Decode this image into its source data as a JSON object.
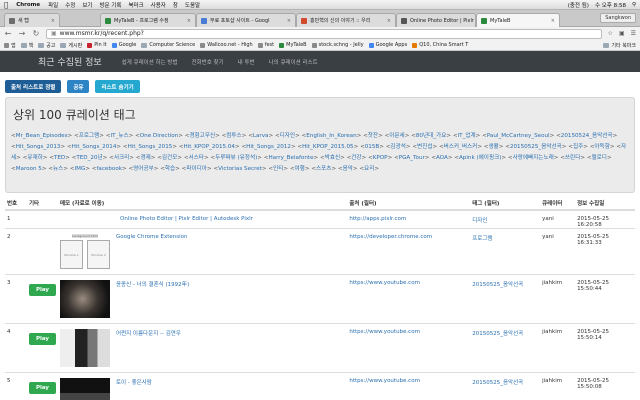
{
  "menubar": {
    "app": "Chrome",
    "items": [
      "파일",
      "수정",
      "보기",
      "방문 기록",
      "북마크",
      "사용자",
      "창",
      "도움말"
    ],
    "status": "(충전 됨)",
    "clock": "수 오후 8:58"
  },
  "tabs": [
    {
      "label": "새 탭",
      "active": false,
      "color": "#6d6d6d"
    },
    {
      "label": "MyTaleB - 프로그램 수정",
      "active": false,
      "color": "#2b8a3e"
    },
    {
      "label": "무료 포토샵 사이트 - Googl",
      "active": false,
      "color": "#4a7bd3"
    },
    {
      "label": "홍민혁의 신의 이야기 :: 우리",
      "active": false,
      "color": "#d04a2b"
    },
    {
      "label": "Online Photo Editor | Pixlr",
      "active": false,
      "color": "#555"
    },
    {
      "label": "MyTaleB",
      "active": true,
      "color": "#2b8a3e"
    }
  ],
  "profile": "Sangkwon",
  "address": {
    "prefix": "www.",
    "url": "www.msmr.kr/q/recent.php?"
  },
  "bookmarks": [
    "앱",
    "책",
    "공고",
    "게시판",
    "Pin It",
    "Google",
    "Computer Science",
    "Wallcoo.net - High",
    "fest",
    "MyTaleB",
    "stock.schng - Jelly",
    "Google Apps",
    "Q10, China Smart T",
    "기타 북마크"
  ],
  "site": {
    "brand": "최근 수집된 정보",
    "nav": [
      "쉽게 큐레이션 하는 방법",
      "전화번호 찾기",
      "내 투번",
      "나의 큐레이션 리스트"
    ]
  },
  "buttons": [
    {
      "label": "출처 리스트로 정렬",
      "color": "#1f5d96"
    },
    {
      "label": "공유",
      "color": "#2d84c5"
    },
    {
      "label": "리스트 숨기기",
      "color": "#25a8d0"
    }
  ],
  "well": {
    "title": "상위 100 큐레이션 태그",
    "tags": [
      "Mr_Bean_Episodes",
      "프로그램",
      "IT_뉴스",
      "One Direction",
      "경험고무신",
      "컴투스",
      "Larva",
      "디자인",
      "English_In_Korean",
      "찻잔",
      "이문세",
      "80년대_가요",
      "IT_업계",
      "Paul_McCartney_Seoul",
      "20150524_음악선곡",
      "Hit_Songs_2013",
      "Hit_Songs_2014",
      "Hit_Songs_2015",
      "Hit_KPOP_2015.04",
      "Hit_Songs_2012",
      "Hit_KPOP_2015.05",
      "015B",
      "김광석",
      "변진섭",
      "버스커_버스커",
      "생활",
      "20150525_음악선곡",
      "집주",
      "아득함",
      "자세",
      "유재하",
      "TED",
      "TED_20년",
      "서크리",
      "경제",
      "김건모",
      "서스타",
      "두루짜뷰 (유정석)",
      "Harry_Belafonte",
      "박효신",
      "건강",
      "KPOP",
      "PGA_Tour",
      "AOA",
      "Apink (에이핑크)",
      "사랑에빠지는노래",
      "쓰린다",
      "멜로디",
      "Maroon 5",
      "뉴스",
      "IMG",
      "facebook",
      "영어공부",
      "학습",
      "파이디아",
      "Victorias Secret",
      "인티",
      "여행",
      "스포츠",
      "음악",
      "요리"
    ]
  },
  "table": {
    "headers": [
      "번호",
      "기타",
      "메모 (자료로 이동)",
      "출처 (필터)",
      "태그 (필터)",
      "큐레이터",
      "정보 수집일"
    ],
    "rows": [
      {
        "no": "1",
        "play": false,
        "memo": "Online Photo Editor | Pixlr Editor | Autodesk Pixlr",
        "source": "http://apps.pixlr.com",
        "tag": "디자인",
        "curator": "yani",
        "date": "2015-05-25 16:20:58",
        "thumb": "none"
      },
      {
        "no": "2",
        "play": false,
        "memo": "Google Chrome Extension",
        "source": "https://developer.chrome.com",
        "tag": "프로그램",
        "curator": "yani",
        "date": "2015-05-25 16:31:33",
        "thumb": "windows"
      },
      {
        "no": "3",
        "play": true,
        "memo": "윤종신 - 너의 결혼식 (1992年)",
        "source": "https://www.youtube.com",
        "tag": "20150525_음악선곡",
        "curator": "jiahkim",
        "date": "2015-05-25 15:50:44",
        "thumb": "video1"
      },
      {
        "no": "4",
        "play": true,
        "memo": "어쩐지 이름다운지 -- 김연우",
        "source": "https://www.youtube.com",
        "tag": "20150525_음악선곡",
        "curator": "jiahkim",
        "date": "2015-05-25 15:50:14",
        "thumb": "video2"
      },
      {
        "no": "5",
        "play": true,
        "memo": "토이 - 좋은사람",
        "source": "https://www.youtube.com",
        "tag": "20150525_음악선곡",
        "curator": "jiahkim",
        "date": "2015-05-25 15:50:08",
        "thumb": "video3"
      }
    ],
    "play_label": "Play",
    "window_label": "Window 1",
    "window_label2": "Window 2",
    "window_label3": "background.html"
  }
}
